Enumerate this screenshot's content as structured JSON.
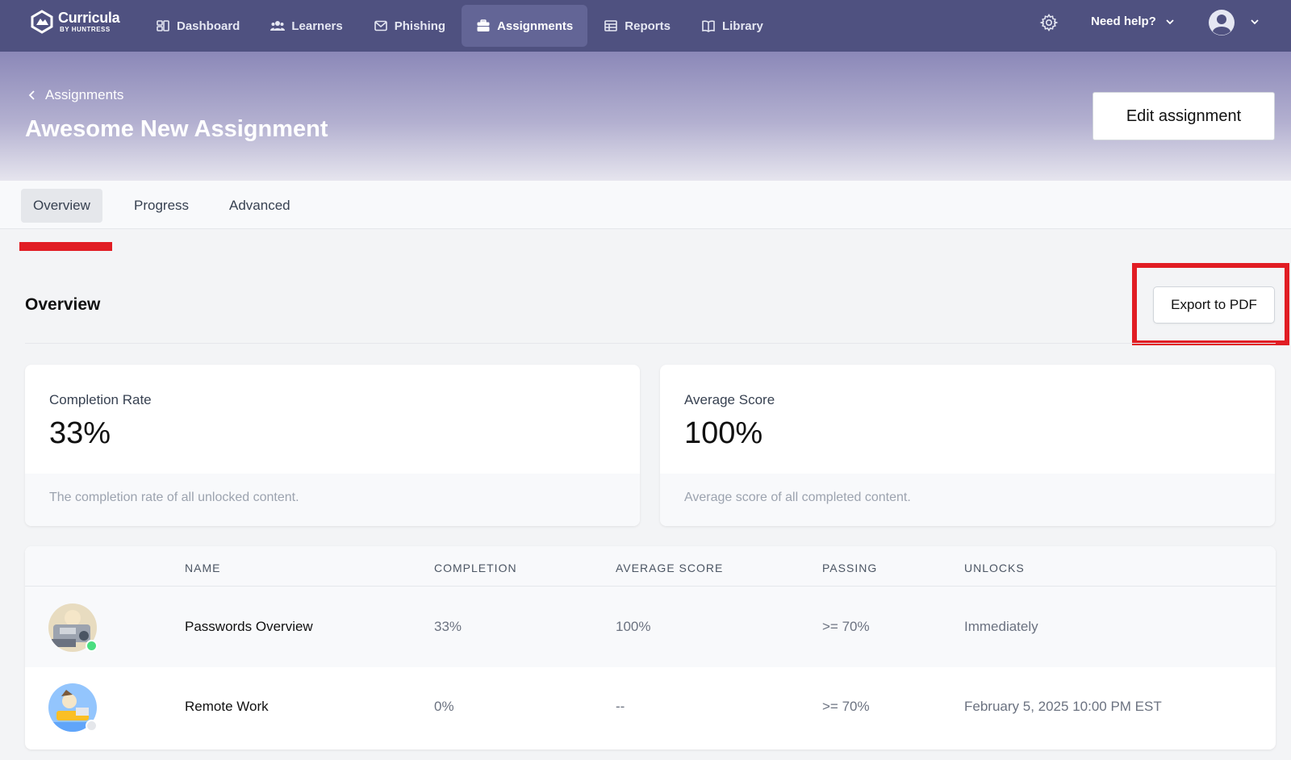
{
  "brand": {
    "name": "Curricula",
    "sub": "BY HUNTRESS"
  },
  "nav": {
    "items": [
      {
        "label": "Dashboard",
        "icon": "dashboard-icon"
      },
      {
        "label": "Learners",
        "icon": "users-icon"
      },
      {
        "label": "Phishing",
        "icon": "mail-icon"
      },
      {
        "label": "Assignments",
        "icon": "briefcase-icon",
        "active": true
      },
      {
        "label": "Reports",
        "icon": "table-icon"
      },
      {
        "label": "Library",
        "icon": "book-icon"
      }
    ],
    "help_label": "Need help?"
  },
  "header": {
    "breadcrumb": "Assignments",
    "title": "Awesome New Assignment",
    "edit_label": "Edit assignment"
  },
  "tabs": [
    {
      "label": "Overview",
      "active": true
    },
    {
      "label": "Progress"
    },
    {
      "label": "Advanced"
    }
  ],
  "section": {
    "title": "Overview",
    "export_label": "Export to PDF"
  },
  "stats": [
    {
      "label": "Completion Rate",
      "value": "33%",
      "description": "The completion rate of all unlocked content."
    },
    {
      "label": "Average Score",
      "value": "100%",
      "description": "Average score of all completed content."
    }
  ],
  "table": {
    "headers": [
      "NAME",
      "COMPLETION",
      "AVERAGE SCORE",
      "PASSING",
      "UNLOCKS"
    ],
    "rows": [
      {
        "name": "Passwords Overview",
        "completion": "33%",
        "average_score": "100%",
        "passing": ">= 70%",
        "unlocks": "Immediately",
        "status": "unlocked"
      },
      {
        "name": "Remote Work",
        "completion": "0%",
        "average_score": "--",
        "passing": ">= 70%",
        "unlocks": "February 5, 2025 10:00 PM EST",
        "status": "locked"
      }
    ]
  },
  "colors": {
    "nav_bg": "#4f5180",
    "nav_active": "#636596",
    "highlight": "#e11d24",
    "status_unlocked": "#4ade80",
    "status_locked": "#e5e7eb"
  }
}
